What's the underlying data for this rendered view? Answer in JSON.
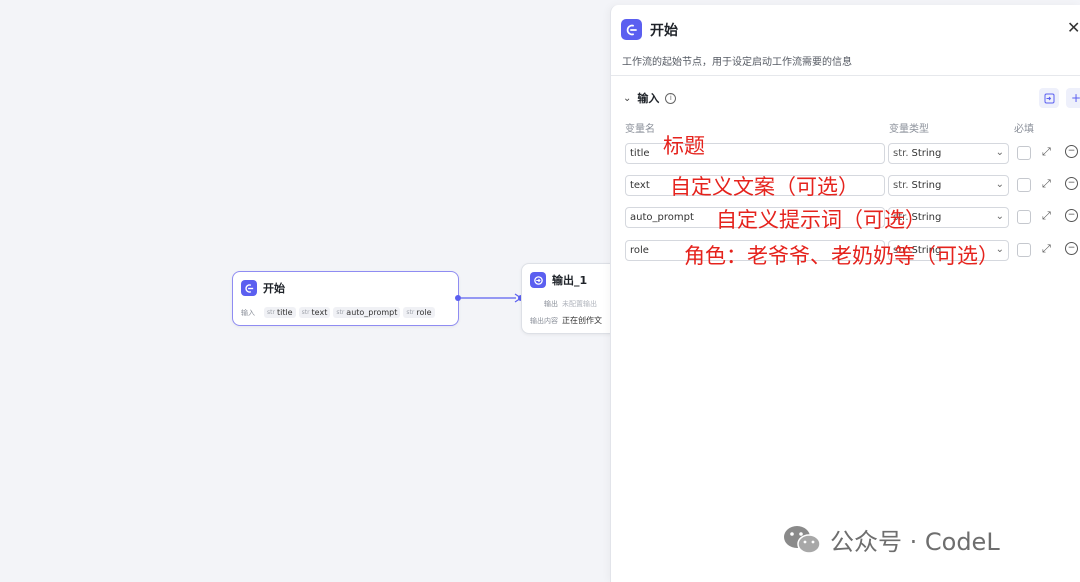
{
  "canvas": {
    "start_node": {
      "title": "开始",
      "input_label": "输入",
      "tags": [
        {
          "type": "str",
          "name": "title"
        },
        {
          "type": "str",
          "name": "text"
        },
        {
          "type": "str",
          "name": "auto_prompt"
        },
        {
          "type": "str",
          "name": "role"
        }
      ]
    },
    "output_node": {
      "title": "输出_1",
      "output_label": "输出",
      "output_value": "未配置输出",
      "content_label": "输出内容",
      "content_value": "正在创作文"
    }
  },
  "panel": {
    "title": "开始",
    "description": "工作流的起始节点，用于设定启动工作流需要的信息",
    "section_title": "输入",
    "columns": {
      "name": "变量名",
      "type": "变量类型",
      "required": "必填"
    },
    "rows": [
      {
        "name": "title",
        "type_prefix": "str.",
        "type": "String"
      },
      {
        "name": "text",
        "type_prefix": "str.",
        "type": "String"
      },
      {
        "name": "auto_prompt",
        "type_prefix": "str.",
        "type": "String"
      },
      {
        "name": "role",
        "type_prefix": "str.",
        "type": "String"
      }
    ]
  },
  "annotations": [
    "标题",
    "自定义文案（可选）",
    "自定义提示词（可选）",
    "角色：老爷爷、老奶奶等（可选）"
  ],
  "watermark": "公众号 · CodeL",
  "colors": {
    "accent": "#5b5ff0",
    "annotation": "#e5231d"
  }
}
